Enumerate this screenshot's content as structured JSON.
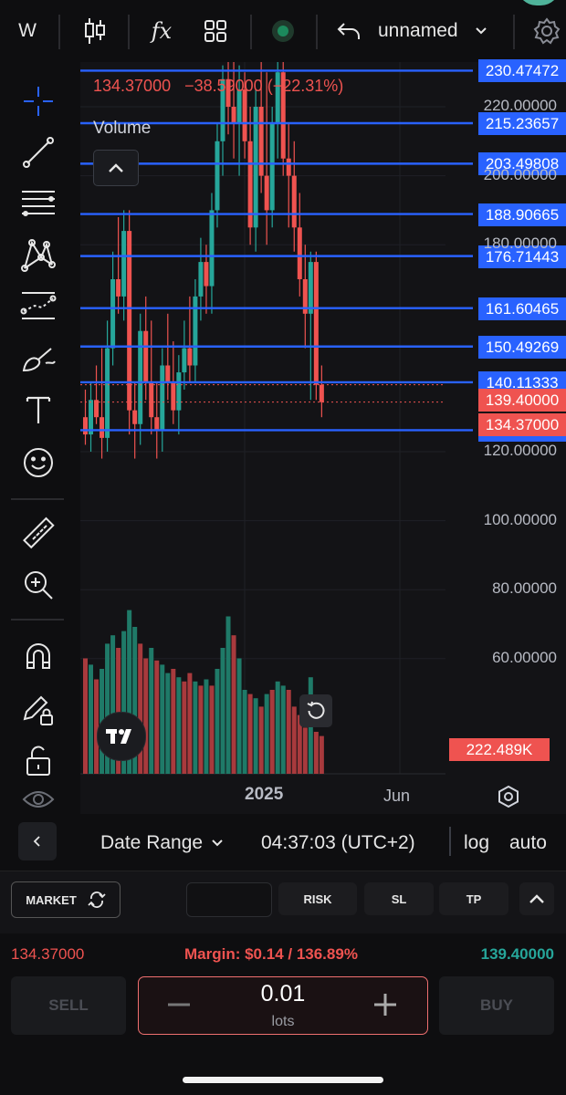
{
  "toolbar": {
    "symbol": "W",
    "fx_icon": "fx",
    "layout_name": "unnamed"
  },
  "chart": {
    "info_price": "134.37000",
    "info_change": "−38.59000 (−22.31%)",
    "volume_label": "Volume",
    "horizontal_lines": [
      "230.47472",
      "215.23657",
      "203.49808",
      "188.90665",
      "176.71443",
      "161.60465",
      "150.49269",
      "140.11333",
      "126.23230"
    ],
    "axis_ticks": [
      "220.00000",
      "200.00000",
      "180.00000",
      "120.00000",
      "100.00000",
      "80.00000",
      "60.00000"
    ],
    "badge_close": "139.40000",
    "badge_current": "134.37000",
    "volume_badge": "222.489K",
    "time_labels": [
      "2025",
      "Jun"
    ],
    "colors": {
      "up": "#26a69a",
      "down": "#ef5350",
      "line": "#2962ff"
    }
  },
  "chart_data": {
    "type": "candlestick",
    "last_price": 134.37,
    "change": -38.59,
    "change_percent": -22.31,
    "horizontal_levels": [
      230.47472,
      215.23657,
      203.49808,
      188.90665,
      176.71443,
      161.60465,
      150.49269,
      140.11333,
      126.2323
    ],
    "ylim": [
      45,
      240
    ],
    "candles": [
      [
        130,
        138,
        122,
        125
      ],
      [
        125,
        140,
        120,
        135
      ],
      [
        135,
        145,
        128,
        130
      ],
      [
        130,
        150,
        118,
        124
      ],
      [
        124,
        158,
        120,
        150
      ],
      [
        150,
        178,
        145,
        170
      ],
      [
        170,
        188,
        160,
        165
      ],
      [
        165,
        190,
        158,
        184
      ],
      [
        184,
        190,
        125,
        132
      ],
      [
        132,
        140,
        118,
        128
      ],
      [
        128,
        160,
        122,
        155
      ],
      [
        155,
        165,
        135,
        140
      ],
      [
        140,
        158,
        125,
        130
      ],
      [
        130,
        140,
        118,
        126
      ],
      [
        126,
        150,
        120,
        145
      ],
      [
        145,
        160,
        135,
        140
      ],
      [
        140,
        152,
        128,
        132
      ],
      [
        132,
        148,
        125,
        143
      ],
      [
        143,
        158,
        138,
        150
      ],
      [
        150,
        165,
        140,
        145
      ],
      [
        145,
        170,
        140,
        165
      ],
      [
        165,
        182,
        158,
        175
      ],
      [
        175,
        180,
        160,
        168
      ],
      [
        168,
        195,
        160,
        190
      ],
      [
        190,
        215,
        185,
        210
      ],
      [
        210,
        232,
        200,
        228
      ],
      [
        228,
        240,
        212,
        220
      ],
      [
        220,
        238,
        205,
        215
      ],
      [
        215,
        232,
        200,
        225
      ],
      [
        225,
        230,
        205,
        210
      ],
      [
        210,
        220,
        180,
        185
      ],
      [
        185,
        225,
        178,
        220
      ],
      [
        220,
        235,
        195,
        200
      ],
      [
        200,
        230,
        180,
        190
      ],
      [
        190,
        220,
        185,
        215
      ],
      [
        215,
        238,
        205,
        230
      ],
      [
        230,
        235,
        200,
        205
      ],
      [
        205,
        215,
        185,
        200
      ],
      [
        200,
        210,
        178,
        185
      ],
      [
        185,
        195,
        165,
        170
      ],
      [
        170,
        180,
        150,
        160
      ],
      [
        160,
        178,
        135,
        175
      ],
      [
        175,
        178,
        135,
        139.4
      ],
      [
        139.4,
        145,
        130,
        134.37
      ]
    ],
    "volume_max_label": "222.489K",
    "volume": [
      [
        "d",
        55
      ],
      [
        "u",
        52
      ],
      [
        "d",
        45
      ],
      [
        "u",
        50
      ],
      [
        "u",
        62
      ],
      [
        "u",
        66
      ],
      [
        "d",
        60
      ],
      [
        "u",
        68
      ],
      [
        "u",
        78
      ],
      [
        "u",
        70
      ],
      [
        "d",
        62
      ],
      [
        "d",
        55
      ],
      [
        "u",
        60
      ],
      [
        "d",
        54
      ],
      [
        "u",
        52
      ],
      [
        "u",
        48
      ],
      [
        "d",
        50
      ],
      [
        "u",
        46
      ],
      [
        "d",
        44
      ],
      [
        "d",
        48
      ],
      [
        "u",
        44
      ],
      [
        "d",
        42
      ],
      [
        "u",
        45
      ],
      [
        "d",
        42
      ],
      [
        "u",
        50
      ],
      [
        "u",
        60
      ],
      [
        "u",
        75
      ],
      [
        "d",
        66
      ],
      [
        "u",
        55
      ],
      [
        "u",
        40
      ],
      [
        "d",
        38
      ],
      [
        "u",
        36
      ],
      [
        "d",
        32
      ],
      [
        "u",
        38
      ],
      [
        "d",
        40
      ],
      [
        "u",
        44
      ],
      [
        "u",
        42
      ],
      [
        "d",
        40
      ],
      [
        "d",
        32
      ],
      [
        "d",
        28
      ],
      [
        "d",
        22
      ],
      [
        "u",
        46
      ],
      [
        "d",
        20
      ],
      [
        "d",
        18
      ]
    ],
    "x_labels": [
      "2025",
      "Jun"
    ]
  },
  "datebar": {
    "date_range": "Date Range",
    "time": "04:37:03 (UTC+2)",
    "log": "log",
    "auto": "auto"
  },
  "trade": {
    "market": "MARKET",
    "risk": "RISK",
    "sl": "SL",
    "tp": "TP",
    "bid": "134.37000",
    "margin": "Margin: $0.14 / 136.89%",
    "ask": "139.40000",
    "sell": "SELL",
    "buy": "BUY",
    "lots_value": "0.01",
    "lots_label": "lots"
  }
}
